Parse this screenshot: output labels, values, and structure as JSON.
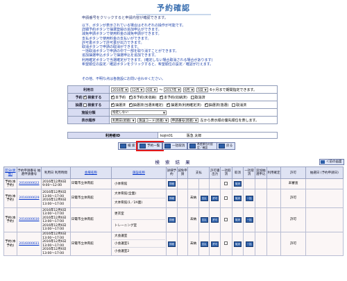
{
  "page": {
    "title": "予約確認"
  },
  "intro": {
    "lead": "申請番号をクリックすると申請内容が確認できます。",
    "notes": [
      "以下、ボタンが表示されている場合はそれぞれの操作が可能です。",
      "詳細予約ボタンで抽選登録の追加申込ができます。",
      "減免申請ボタンで使用料金の減免申請ができます。",
      "支払ボタンで使用料金の支払いができます。",
      "許可書ボタンで許可書が出力できます。",
      "取消ボタンで申請の取消ができます。",
      "一括取消ボタンで申請の中で一部を取り消すことができます。",
      "追加抽選申込ボタンで抽選申込を追加できます。",
      "利用確定ボタンで当選確定ができます。(確定しない場合取消される場合があります)",
      "希望順位の設定／確認ボタンをクリックすると、希望順位の設定／確認が行えます。"
    ],
    "contact": "その他、不明な点は各施設にお問い合わせください。"
  },
  "form": {
    "date": {
      "label": "利用日",
      "from_year": "2016年",
      "from_month": "12月",
      "from_day": "6日",
      "tilde": "～",
      "to_year": "2017年",
      "to_month": "6月",
      "to_day": "5日",
      "note": "6ヶ月まで期間指定できます。"
    },
    "reserve": {
      "label": "予約",
      "opt1": "検索する",
      "opt2": "本予約",
      "opt3": "本予約(未収納)",
      "opt4": "本予約(収納済)",
      "opt5": "取消済"
    },
    "lottery": {
      "label": "抽選",
      "opt1": "検索する",
      "opt2": "抽選済",
      "opt3": "抽選済(当選未確定)",
      "opt4": "抽選済(利用確定済)",
      "opt5": "抽選済(落選)",
      "opt6": "取消済"
    },
    "category": {
      "label": "施設分類",
      "value": "指定しない"
    },
    "order": {
      "label": "表示順序",
      "sel1": "利用日(昇順)",
      "sel2": "施設コード(昇順)",
      "sel3": "申請番号(昇順)",
      "note": "左から表示順の優先順位を表します。"
    }
  },
  "user": {
    "label": "利用者ID",
    "id": "kojin01",
    "name": "阪急 太郎"
  },
  "buttons": {
    "search": "検 索",
    "reserve_list": "予約一覧",
    "bulk_cancel": "一括取消",
    "priority": "希望順位の設定／確認",
    "back": "戻る",
    "prev": "＜前の画面"
  },
  "results": {
    "title": "検 索 結 果",
    "headers": {
      "status": "区分(状態)",
      "apply_no": "予約申請番号 抽選申請番号",
      "datetime": "利用日 利用時間",
      "venue": "会場名称",
      "facility": "施設名称",
      "detail": "詳細予約",
      "reduction": "減免申請",
      "pay": "支払",
      "permit": "許可書出力",
      "bulk": "一括取消",
      "cancel": "取消",
      "bulk2": "一括取消",
      "add_lottery": "追加抽選申込",
      "confirm": "利用確定",
      "permission": "許可",
      "apply_date": "抽選日 (予約申請日)"
    },
    "rows": [
      {
        "status": "予約(本予約)",
        "apply_no": "2016000022",
        "dates": [
          "2016年12月6日",
          "9:00～12:00"
        ],
        "venue": "日電市立体育館",
        "facilities": [
          "小体育館"
        ],
        "pay": "",
        "permission": "未審査"
      },
      {
        "status": "予約(本予約)",
        "apply_no": "2016000029",
        "dates": [
          "2016年12月6日",
          "13:00～17:00",
          "2016年12月6日",
          "13:00～17:00"
        ],
        "venue": "日電市立体育館",
        "facilities": [
          "大体育館(全面)",
          "大体育館(1／2A面)"
        ],
        "pay": "未納",
        "permission": "許可"
      },
      {
        "status": "予約(本予約)",
        "apply_no": "2016000030",
        "dates": [
          "2016年12月6日",
          "13:00～17:00",
          "2016年12月6日",
          "13:00～17:00",
          "2016年12月6日",
          "13:00～17:00"
        ],
        "venue": "日電市立体育館",
        "facilities": [
          "更衣室",
          "トレーニング室"
        ],
        "pay": "未納",
        "permission": "許可"
      },
      {
        "status": "予約(本予約)",
        "apply_no": "2016000031",
        "dates": [
          "2016年12月6日",
          "13:00～17:00",
          "2016年12月6日",
          "13:00～17:00",
          "2016年12月6日",
          "13:00～17:00"
        ],
        "venue": "日電市立体育館",
        "facilities": [
          "大会議室",
          "小会議室1",
          "小会議室2"
        ],
        "pay": "未納",
        "permission": "許可"
      }
    ]
  },
  "icons": {
    "action": "square-button-icon",
    "checkbox": "checkbox-icon"
  },
  "colors": {
    "title": "#3a6fb0",
    "header_bg": "#d8dcf2",
    "button_bg": "#2d5fa8",
    "highlight": "#e51a1a"
  }
}
